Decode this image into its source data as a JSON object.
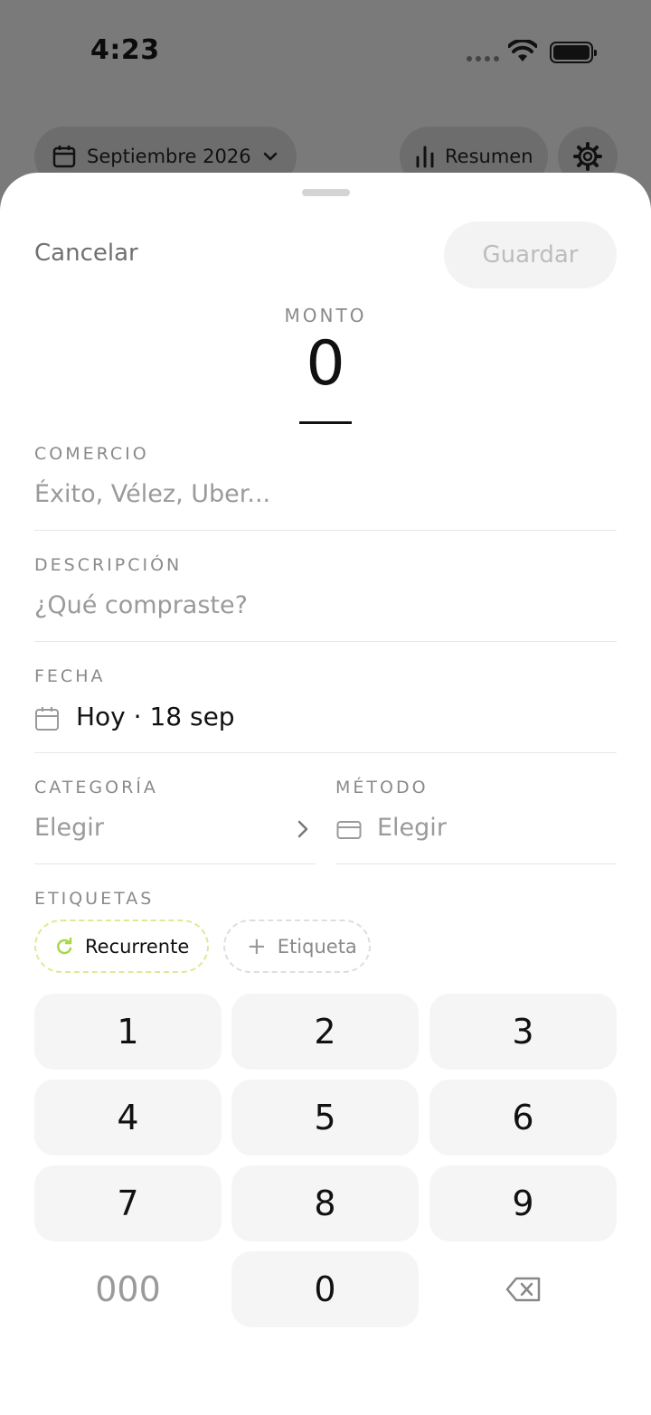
{
  "status_bar": {
    "time": "4:23"
  },
  "header": {
    "month_label": "Septiembre 2026",
    "summary_label": "Resumen"
  },
  "sheet": {
    "cancel_label": "Cancelar",
    "save_label": "Guardar",
    "amount": {
      "label": "MONTO",
      "value": "0"
    },
    "merchant": {
      "label": "COMERCIO",
      "placeholder": "Éxito, Vélez, Uber..."
    },
    "description": {
      "label": "DESCRIPCIÓN",
      "placeholder": "¿Qué compraste?"
    },
    "date": {
      "label": "FECHA",
      "value": "Hoy · 18 sep"
    },
    "category": {
      "label": "CATEGORÍA",
      "value": "Elegir"
    },
    "method": {
      "label": "MÉTODO",
      "value": "Elegir"
    },
    "tags": {
      "label": "ETIQUETAS",
      "items": [
        "Recurrente",
        "Etiqueta"
      ],
      "add_symbol": "+"
    },
    "keypad": {
      "keys": [
        "1",
        "2",
        "3",
        "4",
        "5",
        "6",
        "7",
        "8",
        "9",
        "000",
        "0"
      ]
    }
  },
  "colors": {
    "accent_recurrent": "#a6d84a",
    "overlay": "#7a7a7a"
  },
  "icons": [
    "calendar-icon",
    "chevron-down-icon",
    "bar-chart-icon",
    "gear-icon",
    "refresh-icon",
    "plus-icon",
    "chevron-right-icon",
    "credit-card-icon",
    "backspace-icon"
  ]
}
